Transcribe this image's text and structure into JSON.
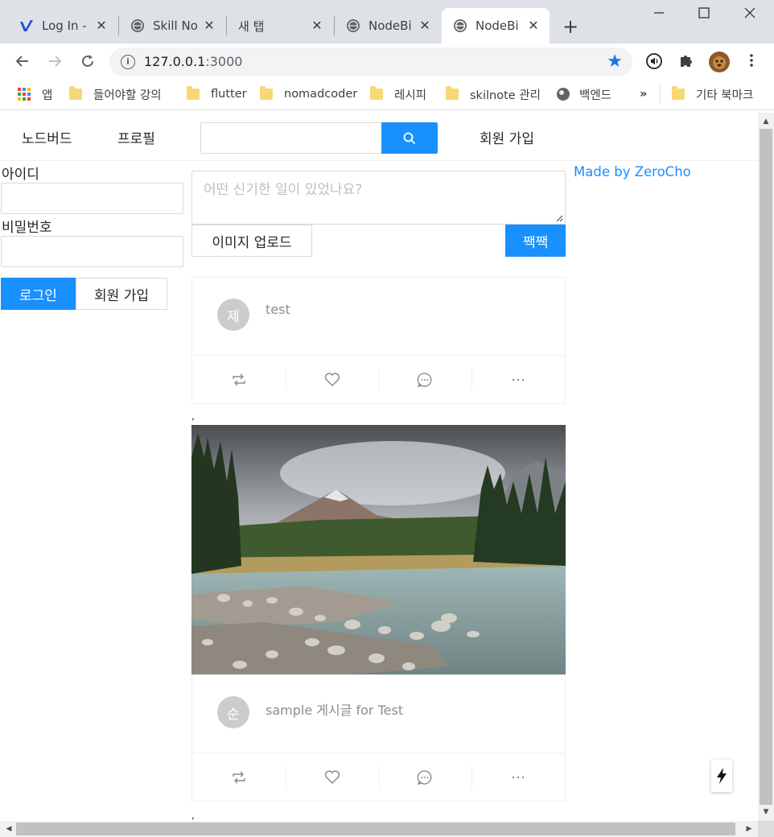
{
  "browser": {
    "tabs": [
      {
        "title": "Log In -",
        "icon": "vimeo-icon"
      },
      {
        "title": "Skill No",
        "icon": "globe-icon"
      },
      {
        "title": "새 탭",
        "icon": ""
      },
      {
        "title": "NodeBir",
        "icon": "globe-icon"
      },
      {
        "title": "NodeBir",
        "icon": "globe-icon",
        "active": true
      }
    ],
    "url_host": "127.0.0.1",
    "url_port": ":3000",
    "bookmarks": [
      {
        "label": "앱",
        "icon": "apps-icon"
      },
      {
        "label": "들어야할 강의",
        "icon": "folder-icon"
      },
      {
        "label": "flutter",
        "icon": "folder-icon"
      },
      {
        "label": "nomadcoder",
        "icon": "folder-icon"
      },
      {
        "label": "레시피",
        "icon": "folder-icon"
      },
      {
        "label": "skilnote 관리",
        "icon": "folder-icon"
      },
      {
        "label": "백엔드",
        "icon": "globe-icon"
      },
      {
        "label": "»",
        "icon": ""
      },
      {
        "label": "기타 북마크",
        "icon": "folder-icon"
      }
    ],
    "accent_color": "#1a73e8"
  },
  "page": {
    "menu": {
      "home": "노드버드",
      "profile": "프로필",
      "signup": "회원 가입",
      "search_placeholder": ""
    },
    "login": {
      "id_label": "아이디",
      "password_label": "비밀번호",
      "login_button": "로그인",
      "signup_button": "회원 가입"
    },
    "post_form": {
      "placeholder": "어떤 신기한 일이 있었나요?",
      "upload_button": "이미지 업로드",
      "submit_button": "짹짹"
    },
    "posts": [
      {
        "avatar": "제",
        "content": "test",
        "has_image": false
      },
      {
        "avatar": "순",
        "content": "sample 게시글 for Test",
        "has_image": true,
        "image": "mountain-river-landscape"
      }
    ],
    "separator": ",",
    "made_by": "Made by ZeroCho",
    "primary_color": "#1890ff"
  }
}
